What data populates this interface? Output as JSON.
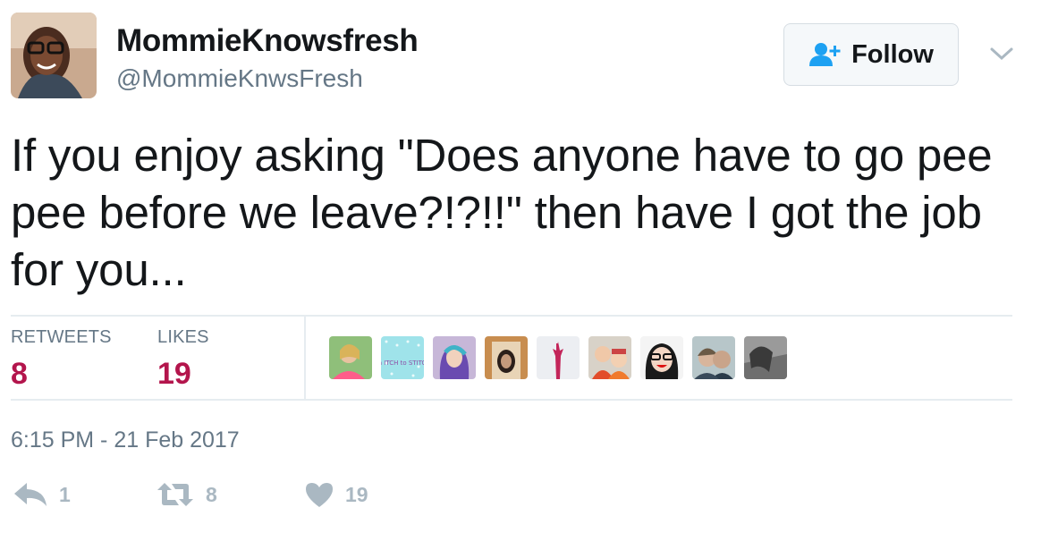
{
  "user": {
    "display_name": "MommieKnowsfresh",
    "handle": "@MommieKnwsFresh"
  },
  "follow_button": {
    "label": "Follow",
    "icon": "follow-user-plus-icon"
  },
  "tweet": {
    "text": "If you enjoy asking \"Does anyone have to go pee pee before we leave?!?!!\" then have I got the job for you..."
  },
  "stats": {
    "retweets_label": "RETWEETS",
    "retweets_value": "8",
    "likes_label": "LIKES",
    "likes_value": "19"
  },
  "likers": [
    {
      "avatar_text": ""
    },
    {
      "avatar_text": "an ITCH to STITCH"
    },
    {
      "avatar_text": ""
    },
    {
      "avatar_text": ""
    },
    {
      "avatar_text": ""
    },
    {
      "avatar_text": ""
    },
    {
      "avatar_text": ""
    },
    {
      "avatar_text": ""
    },
    {
      "avatar_text": ""
    }
  ],
  "timestamp": "6:15 PM - 21 Feb 2017",
  "actions": {
    "reply_count": "1",
    "retweet_count": "8",
    "like_count": "19"
  },
  "colors": {
    "stat_value": "#b3154c",
    "follow_icon": "#1da1f2",
    "muted": "#657786",
    "action_icon": "#aab8c2"
  }
}
